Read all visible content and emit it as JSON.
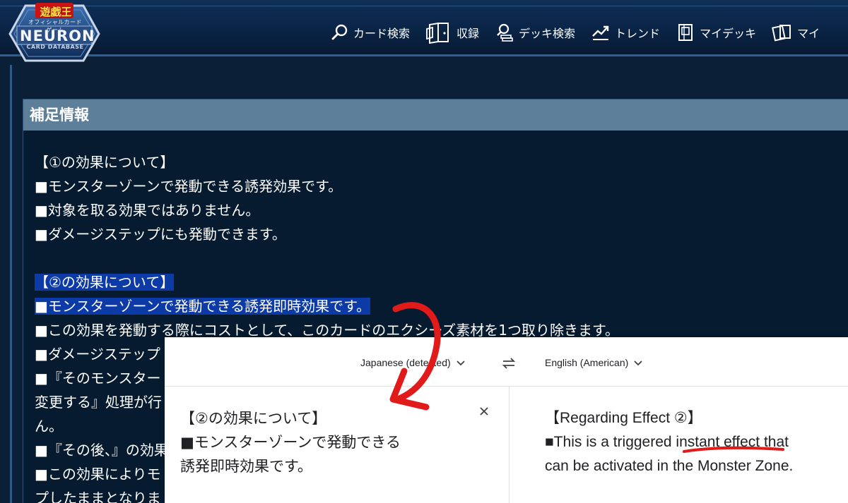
{
  "logo": {
    "yugioh": "遊戯王",
    "subtitle": "オフィシャルカードゲーム",
    "neuron": "NEURON",
    "card_database": "CARD DATABASE"
  },
  "nav": [
    {
      "label": "カード検索",
      "icon": "search-icon"
    },
    {
      "label": "収録",
      "icon": "pack-icon"
    },
    {
      "label": "デッキ検索",
      "icon": "deck-search-icon"
    },
    {
      "label": "トレンド",
      "icon": "trend-icon"
    },
    {
      "label": "マイデッキ",
      "icon": "my-deck-icon"
    },
    {
      "label": "マイ",
      "icon": "my-cards-icon"
    }
  ],
  "panel": {
    "title": "補足情報",
    "lines": [
      "【①の効果について】",
      "■モンスターゾーンで発動できる誘発効果です。",
      "■対象を取る効果ではありません。",
      "■ダメージステップにも発動できます。",
      "",
      "【②の効果について】",
      "■モンスターゾーンで発動できる誘発即時効果です。",
      "■この効果を発動する際にコストとして、このカードのエクシーズ素材を1つ取り除きます。",
      "■ダメージステップ",
      "■『そのモンスター",
      "変更する』処理が行",
      "ん。",
      "■『その後、』の効果",
      "■この効果によりモ",
      "プしたままとなりま"
    ]
  },
  "translate": {
    "source_lang": "Japanese (detected)",
    "target_lang": "English (American)",
    "source_lines": [
      "【②の効果について】",
      "■モンスターゾーンで発動できる",
      "誘発即時効果です。"
    ],
    "target_heading": "【Regarding Effect ②】",
    "target_pre": "■This is a triggered ",
    "target_highlight": "instant effect",
    "target_post": " that",
    "target_line3": "can be activated in the Monster Zone."
  },
  "colors": {
    "header_bg": "#0a2446",
    "panel_bg": "#061b2f",
    "panel_header": "#5e7f99",
    "highlight": "#0c3aa6",
    "annotation_red": "#e11a1a"
  }
}
